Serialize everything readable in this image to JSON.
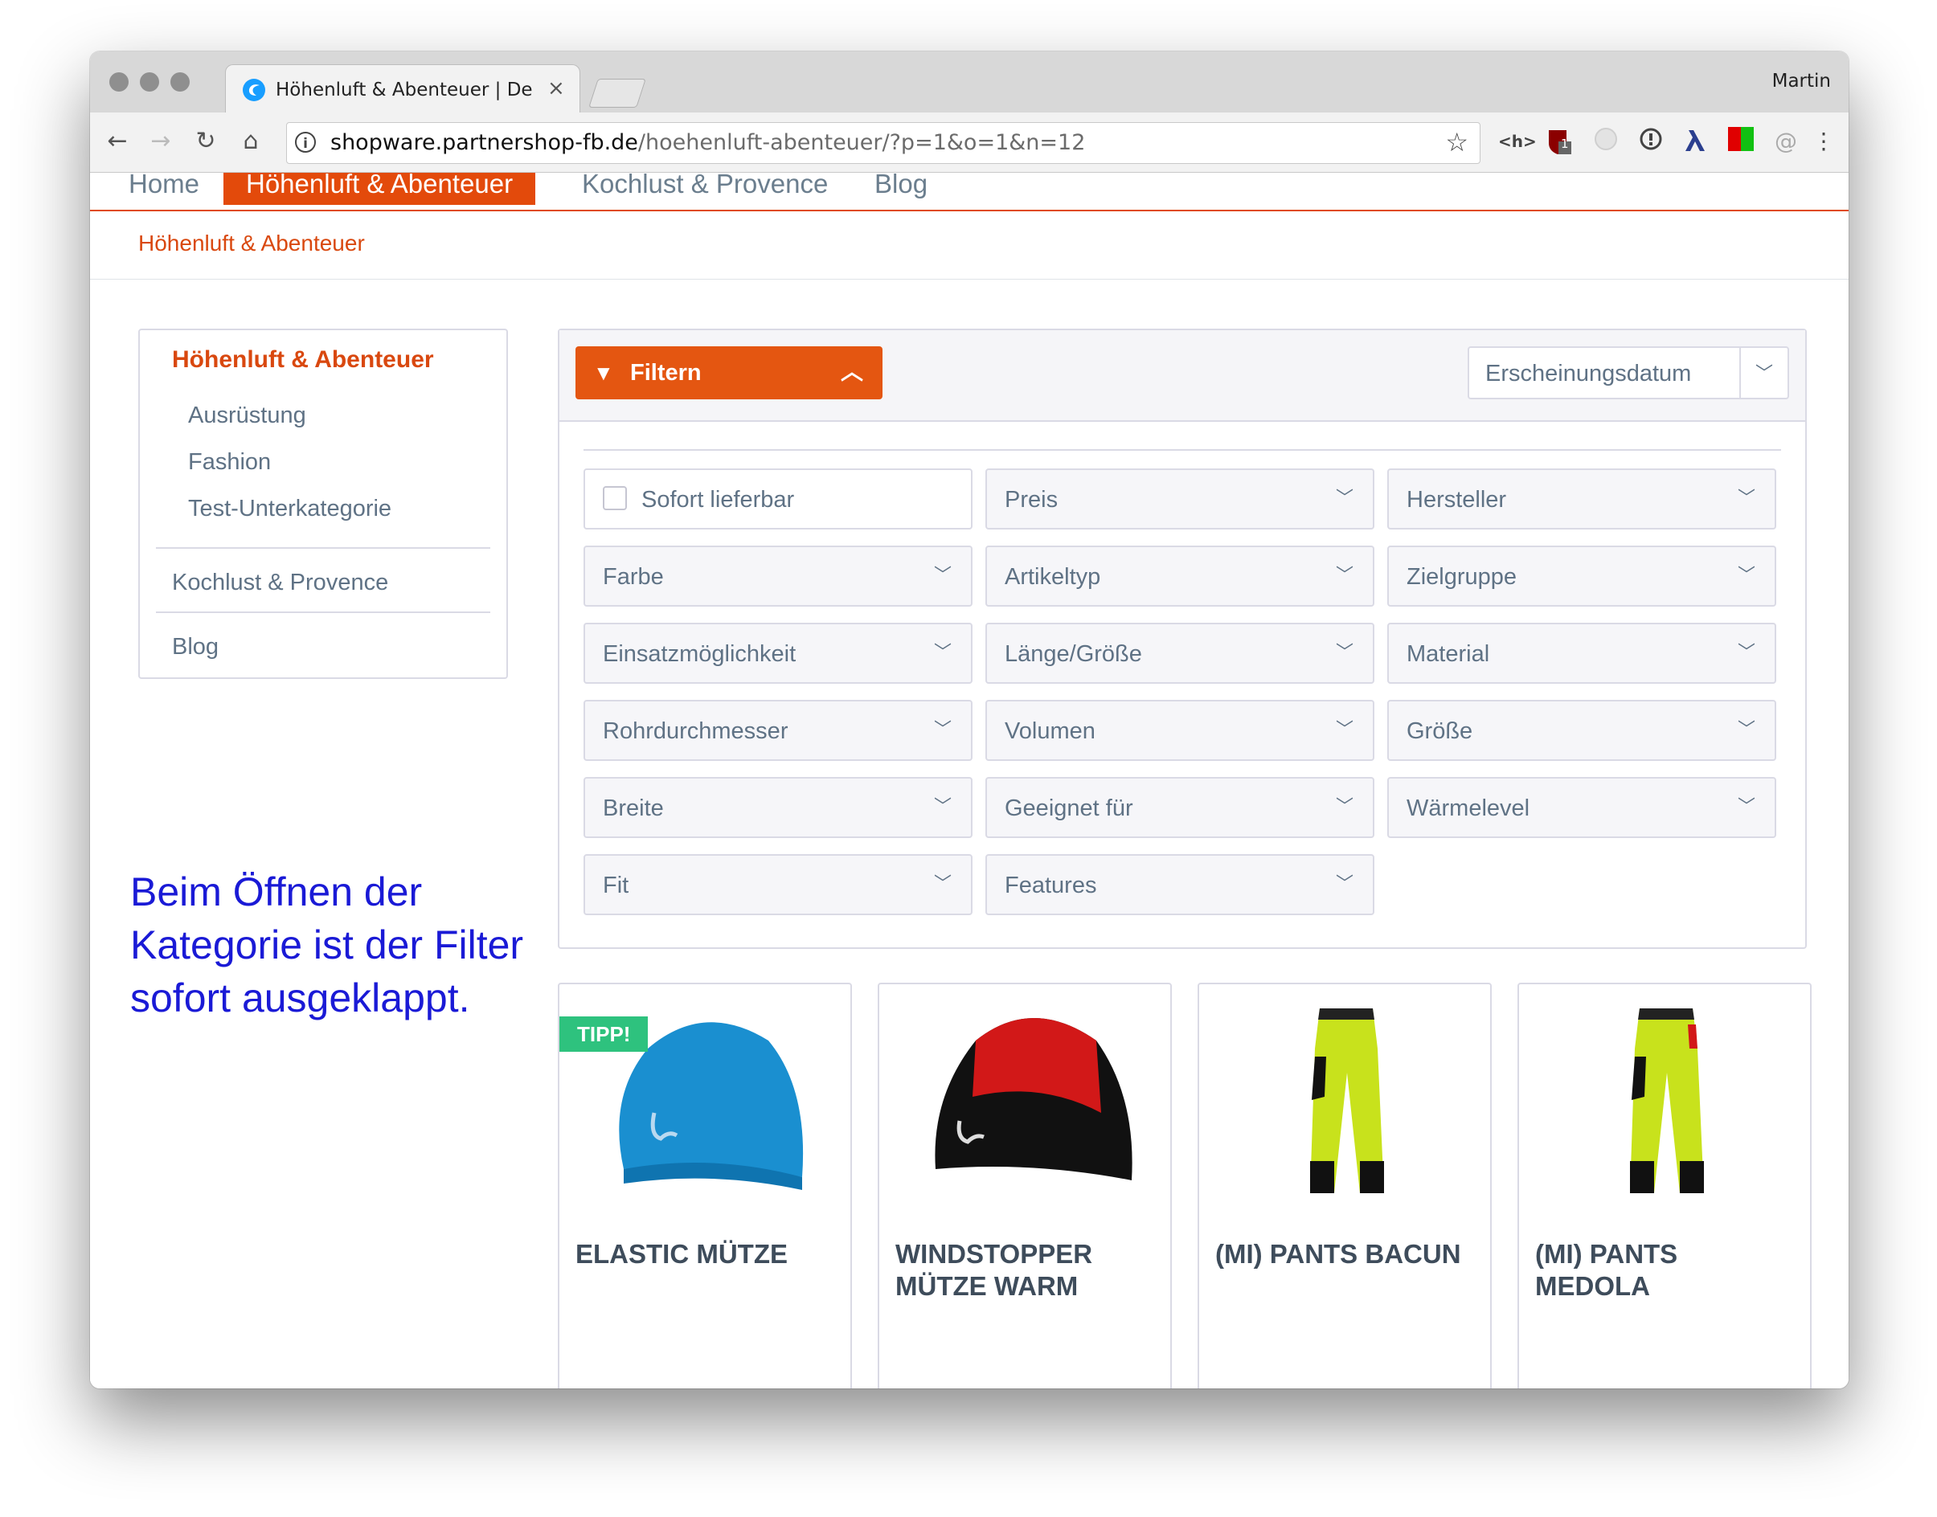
{
  "browser": {
    "tab_title": "Höhenluft & Abenteuer | Demo",
    "profile_name": "Martin",
    "url_host": "shopware.partnershop-fb.de",
    "url_path": "/hoehenluft-abenteuer/?p=1&o=1&n=12",
    "extensions": [
      "<h>",
      "ublock-icon",
      "grey-circle-icon",
      "info-circle-icon",
      "lambda-icon",
      "red-green-icon",
      "at-icon",
      "menu-dots-icon"
    ],
    "ext_html_label": "<h>",
    "ublock_count": "1"
  },
  "nav": {
    "items": [
      "Home",
      "Höhenluft & Abenteuer",
      "Kochlust & Provence",
      "Blog"
    ],
    "active": "Höhenluft & Abenteuer"
  },
  "breadcrumb": "Höhenluft & Abenteuer",
  "sidebar": {
    "heading": "Höhenluft & Abenteuer",
    "subitems": [
      "Ausrüstung",
      "Fashion",
      "Test-Unterkategorie"
    ],
    "items": [
      "Kochlust & Provence",
      "Blog"
    ]
  },
  "annotation": "Beim Öffnen der Kategorie ist der Filter sofort ausgeklappt.",
  "filter": {
    "button_label": "Filtern",
    "sort_value": "Erscheinungsdatum",
    "checkbox_label": "Sofort lieferbar",
    "fields": [
      "Preis",
      "Hersteller",
      "Farbe",
      "Artikeltyp",
      "Zielgruppe",
      "Einsatzmöglichkeit",
      "Länge/Größe",
      "Material",
      "Rohrdurchmesser",
      "Volumen",
      "Größe",
      "Breite",
      "Geeignet für",
      "Wärmelevel",
      "Fit",
      "Features"
    ]
  },
  "products": [
    {
      "name": "Elastic Mütze",
      "badge": "TIPP!"
    },
    {
      "name": "Windstopper Mütze warm",
      "badge": ""
    },
    {
      "name": "(MI) Pants Bacun",
      "badge": ""
    },
    {
      "name": "(MI) Pants Medola",
      "badge": ""
    }
  ],
  "colors": {
    "accent": "#e34a0b",
    "badge": "#2ec27e",
    "annotation": "#1a1ad6",
    "text_muted": "#5f7285"
  }
}
